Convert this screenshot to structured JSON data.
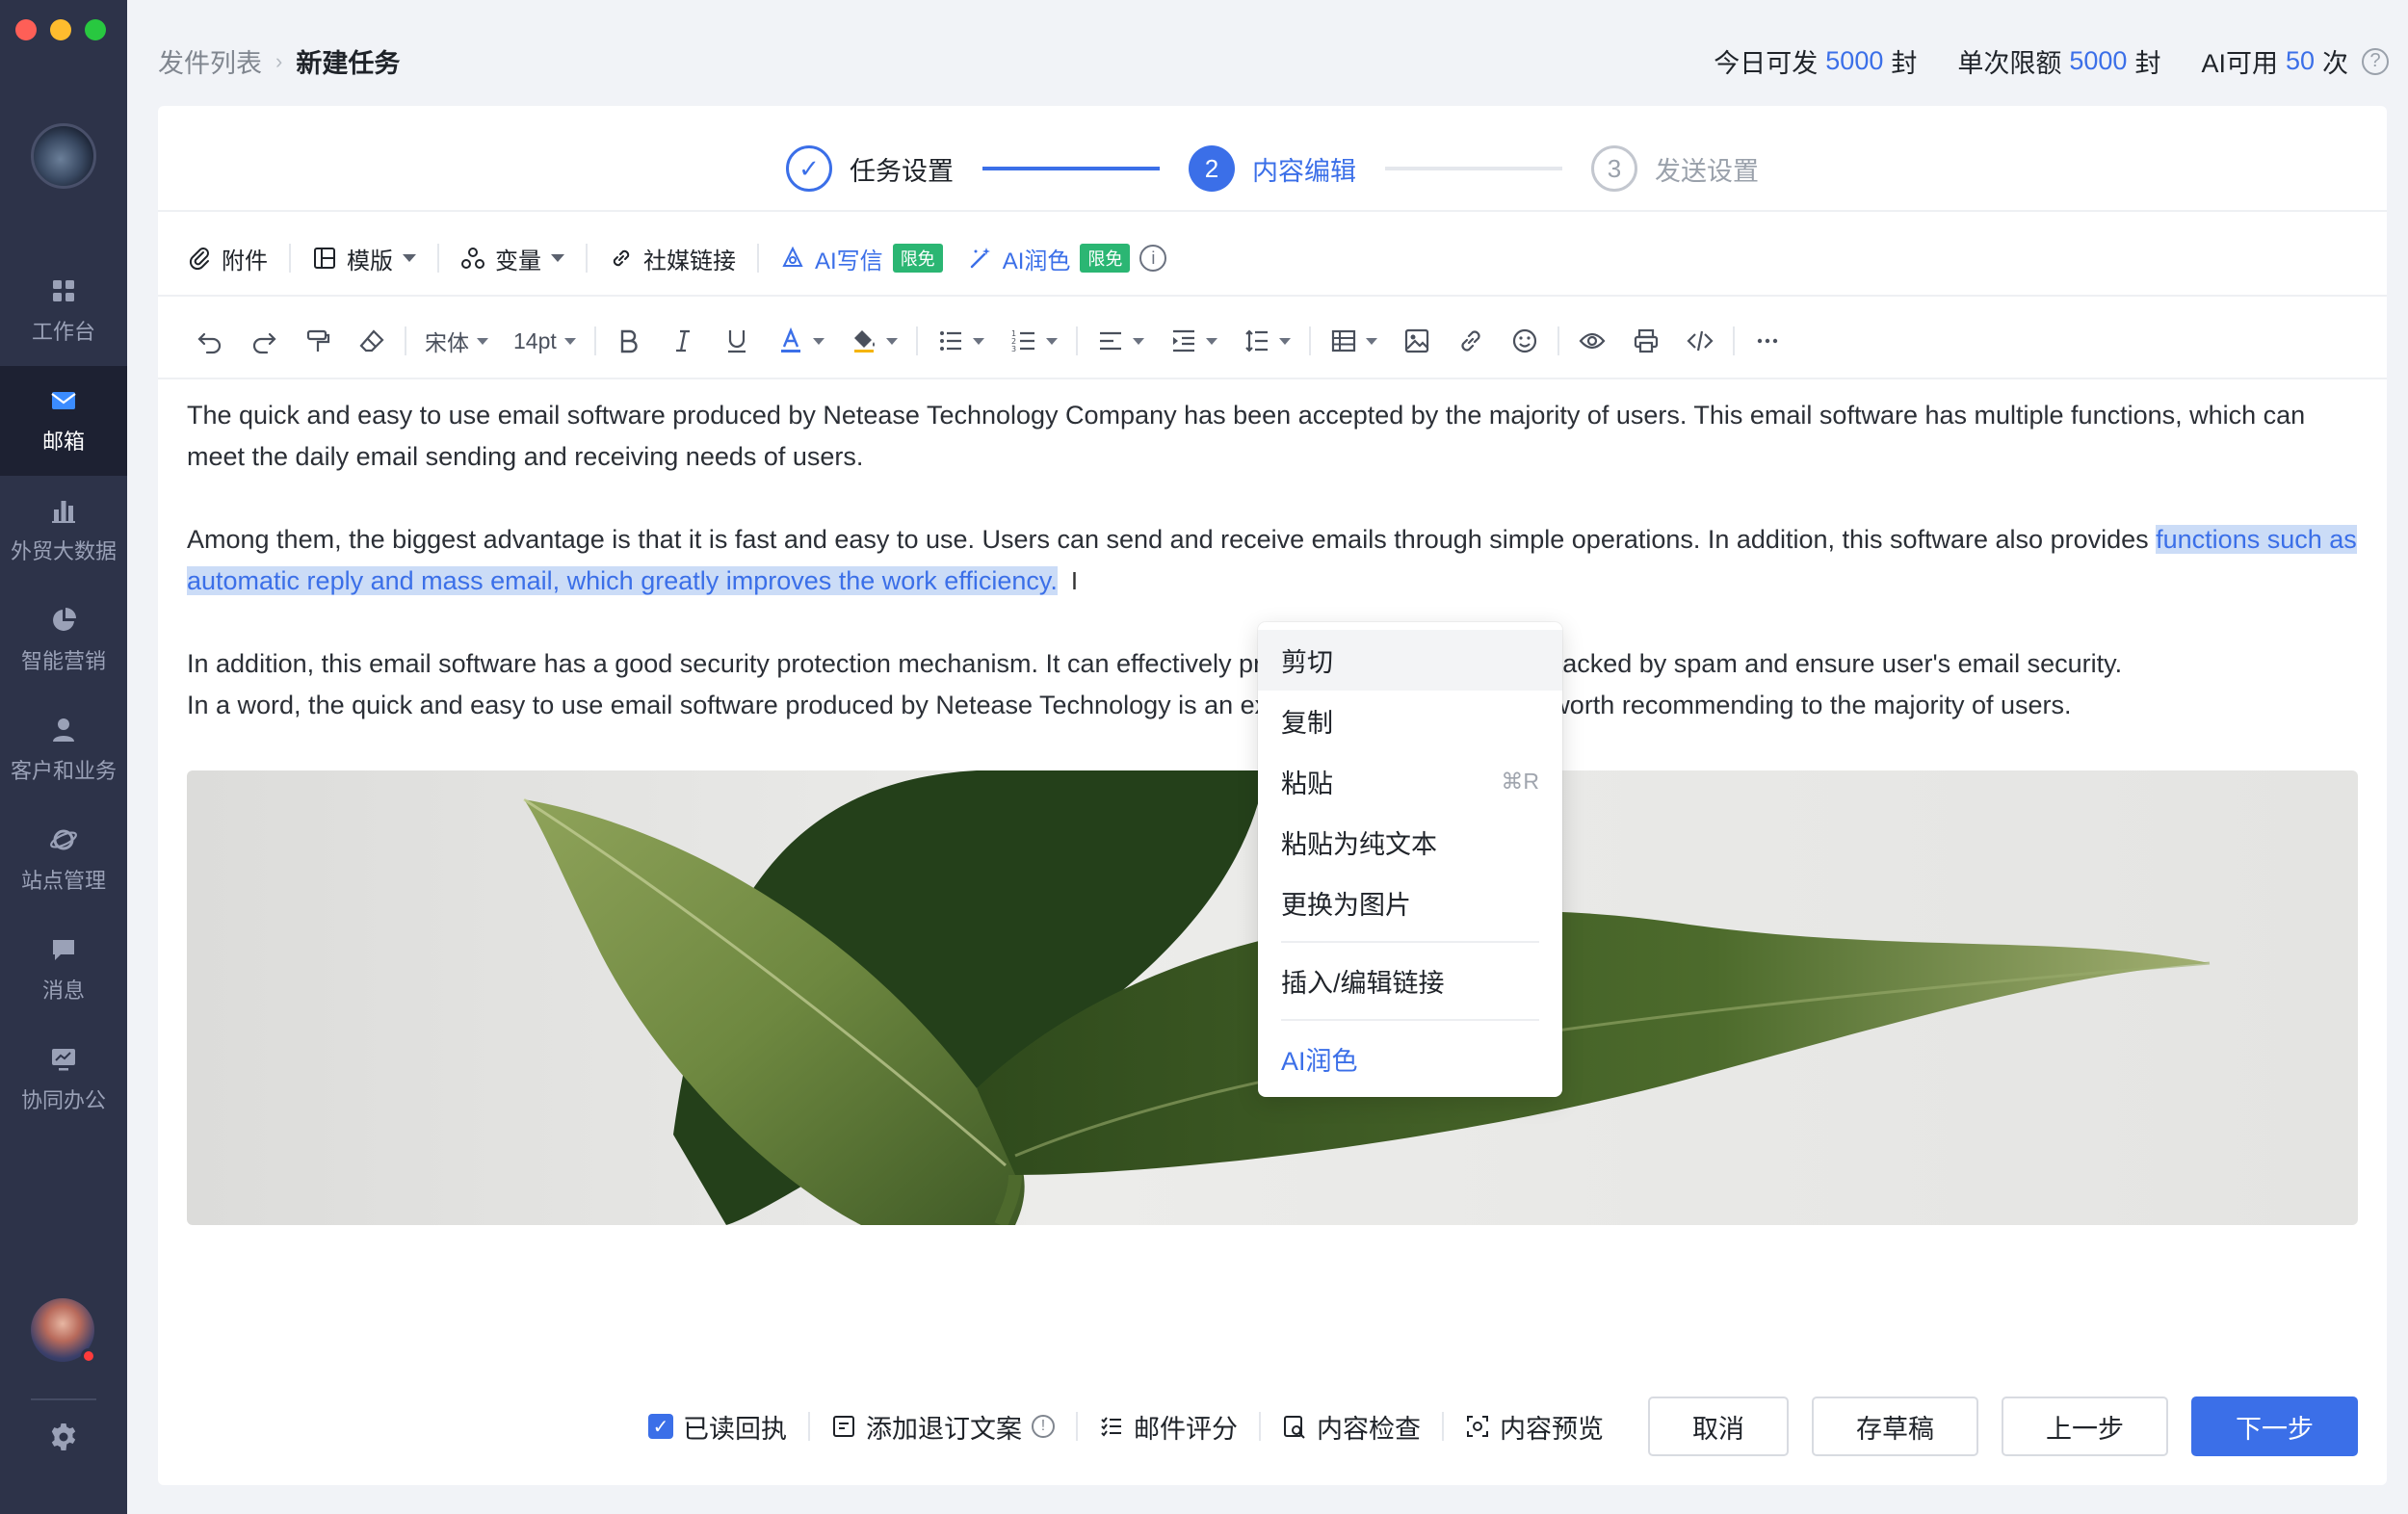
{
  "breadcrumb": {
    "parent": "发件列表",
    "current": "新建任务"
  },
  "quota": {
    "today_label": "今日可发",
    "today_value": "5000",
    "today_unit": "封",
    "single_label": "单次限额",
    "single_value": "5000",
    "single_unit": "封",
    "ai_label": "AI可用",
    "ai_value": "50",
    "ai_unit": "次"
  },
  "sidebar": {
    "items": [
      {
        "label": "工作台",
        "icon": "grid-icon"
      },
      {
        "label": "邮箱",
        "icon": "mail-icon",
        "active": true
      },
      {
        "label": "外贸大数据",
        "icon": "bar-chart-icon"
      },
      {
        "label": "智能营销",
        "icon": "pie-chart-icon"
      },
      {
        "label": "客户和业务",
        "icon": "user-icon"
      },
      {
        "label": "站点管理",
        "icon": "globe-icon"
      },
      {
        "label": "消息",
        "icon": "message-icon"
      },
      {
        "label": "协同办公",
        "icon": "monitor-icon"
      }
    ]
  },
  "steps": [
    {
      "number": "✓",
      "label": "任务设置",
      "state": "done"
    },
    {
      "number": "2",
      "label": "内容编辑",
      "state": "active"
    },
    {
      "number": "3",
      "label": "发送设置",
      "state": "todo"
    }
  ],
  "toolbar1": {
    "attachment": "附件",
    "template": "模版",
    "variable": "变量",
    "social_link": "社媒链接",
    "ai_write": "AI写信",
    "ai_write_badge": "限免",
    "ai_polish": "AI润色",
    "ai_polish_badge": "限免"
  },
  "toolbar2": {
    "font": "宋体",
    "size": "14pt"
  },
  "editor": {
    "p1": "The quick and easy to use email software produced by Netease Technology Company has been accepted by the majority of users. This email software has multiple functions, which can meet the daily email sending and receiving needs of users.",
    "p2_plain": "Among them, the biggest advantage is that it is fast and easy to use. Users can send and receive emails through simple operations. In addition, this software also provides ",
    "p2_selected": "functions such as automatic reply and mass email, which greatly improves the work efficiency.",
    "p3_line1": "In addition, this email software has a good security protection mechanism. It can effectively prevent users from being attacked by spam and ensure user's email security.",
    "p3_line2": "In a word, the quick and easy to use email software produced by Netease Technology is an excellent product, which is worth recommending to the majority of users."
  },
  "context_menu": {
    "cut": "剪切",
    "copy": "复制",
    "paste": "粘贴",
    "paste_shortcut": "⌘R",
    "paste_plain": "粘贴为纯文本",
    "replace_image": "更换为图片",
    "insert_link": "插入/编辑链接",
    "ai_polish": "AI润色"
  },
  "footer": {
    "read_receipt": "已读回执",
    "unsubscribe": "添加退订文案",
    "score": "邮件评分",
    "check": "内容检查",
    "preview": "内容预览",
    "cancel": "取消",
    "draft": "存草稿",
    "prev": "上一步",
    "next": "下一步"
  },
  "colors": {
    "accent": "#3b6fe8",
    "sidebar": "#2d3349",
    "badge": "#2bb673"
  }
}
